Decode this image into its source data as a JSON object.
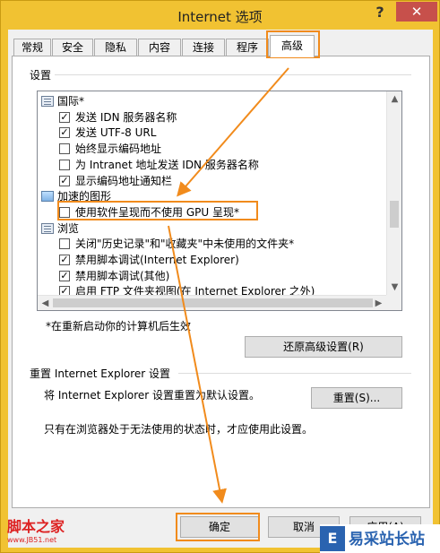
{
  "window": {
    "title": "Internet 选项",
    "help_glyph": "?",
    "close_glyph": "✕"
  },
  "tabs": [
    {
      "label": "常规"
    },
    {
      "label": "安全"
    },
    {
      "label": "隐私"
    },
    {
      "label": "内容"
    },
    {
      "label": "连接"
    },
    {
      "label": "程序"
    },
    {
      "label": "高级"
    }
  ],
  "settings": {
    "label": "设置",
    "items": [
      {
        "text": "国际*",
        "kind": "group",
        "icon": "group-icon"
      },
      {
        "text": "发送 IDN 服务器名称",
        "kind": "checkbox",
        "checked": true
      },
      {
        "text": "发送 UTF-8 URL",
        "kind": "checkbox",
        "checked": true
      },
      {
        "text": "始终显示编码地址",
        "kind": "checkbox",
        "checked": false
      },
      {
        "text": "为 Intranet 地址发送 IDN 服务器名称",
        "kind": "checkbox",
        "checked": false
      },
      {
        "text": "显示编码地址通知栏",
        "kind": "checkbox",
        "checked": true
      },
      {
        "text": "加速的图形",
        "kind": "group",
        "icon": "image-icon"
      },
      {
        "text": "使用软件呈现而不使用 GPU 呈现*",
        "kind": "checkbox",
        "checked": false
      },
      {
        "text": "浏览",
        "kind": "group",
        "icon": "group-icon"
      },
      {
        "text": "关闭\"历史记录\"和\"收藏夹\"中未使用的文件夹*",
        "kind": "checkbox",
        "checked": false
      },
      {
        "text": "禁用脚本调试(Internet Explorer)",
        "kind": "checkbox",
        "checked": true
      },
      {
        "text": "禁用脚本调试(其他)",
        "kind": "checkbox",
        "checked": true
      },
      {
        "text": "启用 FTP 文件夹视图(在 Internet Explorer 之外)",
        "kind": "checkbox",
        "checked": true
      }
    ],
    "restart_note": "*在重新启动你的计算机后生效",
    "restore_button": "还原高级设置(R)"
  },
  "reset": {
    "label": "重置 Internet Explorer 设置",
    "description": "将 Internet Explorer 设置重置为默认设置。",
    "reset_button": "重置(S)...",
    "warning": "只有在浏览器处于无法使用的状态时，才应使用此设置。"
  },
  "footer": {
    "ok": "确定",
    "cancel": "取消",
    "apply": "应用(A)"
  },
  "watermarks": {
    "left_title": "脚本之家",
    "left_url": "www.JB51.net",
    "right_logo": "E",
    "right_text": "易采站长站"
  },
  "colors": {
    "highlight": "#f18b1c",
    "frame": "#f1c232",
    "close": "#c7504b"
  }
}
